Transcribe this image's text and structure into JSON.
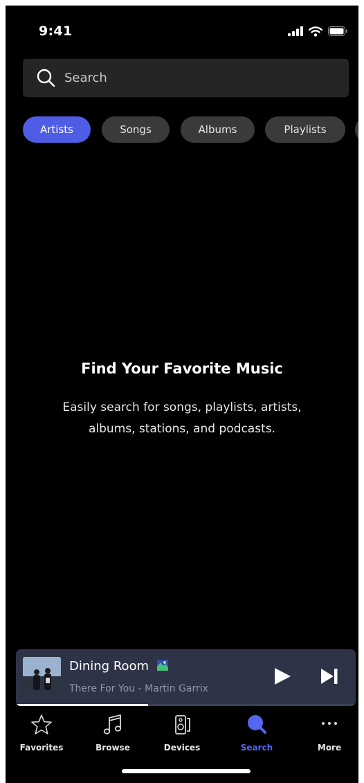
{
  "status_bar": {
    "time": "9:41"
  },
  "search": {
    "placeholder": "Search"
  },
  "filters": [
    {
      "label": "Artists",
      "active": true
    },
    {
      "label": "Songs",
      "active": false
    },
    {
      "label": "Albums",
      "active": false
    },
    {
      "label": "Playlists",
      "active": false
    }
  ],
  "empty_state": {
    "title": "Find Your Favorite Music",
    "description": "Easily search for songs, playlists, artists, albums, stations, and podcasts."
  },
  "now_playing": {
    "room": "Dining Room",
    "track": "There For You - Martin Garrix",
    "progress": 0.39
  },
  "tabs": [
    {
      "label": "Favorites",
      "icon": "star-icon",
      "active": false
    },
    {
      "label": "Browse",
      "icon": "music-note-icon",
      "active": false
    },
    {
      "label": "Devices",
      "icon": "speaker-icon",
      "active": false
    },
    {
      "label": "Search",
      "icon": "search-icon",
      "active": true
    },
    {
      "label": "More",
      "icon": "more-icon",
      "active": false
    }
  ],
  "colors": {
    "background": "#000000",
    "accent": "#5566ef",
    "chip_active": "#4e5ce6",
    "chip": "#3a3a3a",
    "mini_player": "#2e3347",
    "search_field": "#252525"
  }
}
